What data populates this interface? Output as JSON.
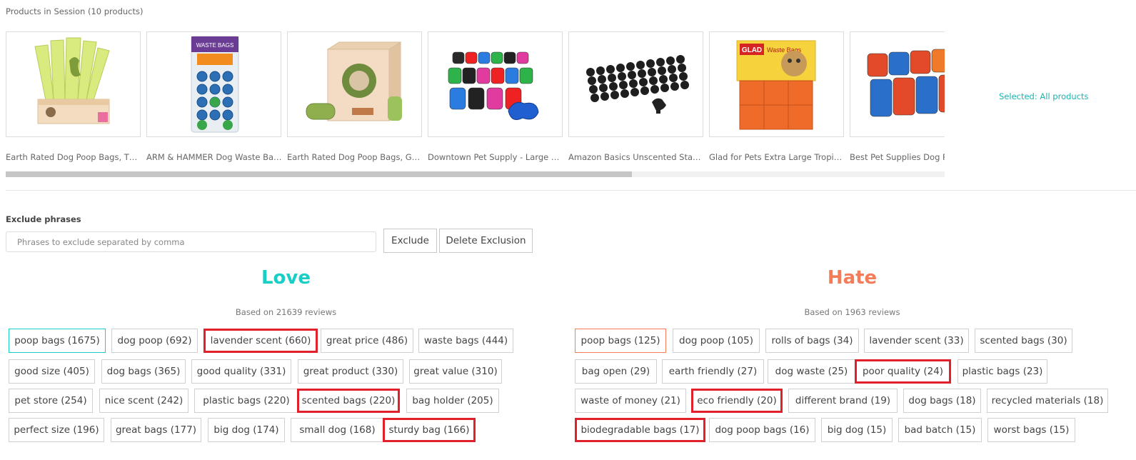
{
  "session": {
    "title": "Products in Session (10 products)",
    "selected_label": "Selected: All products"
  },
  "products": [
    {
      "title": "Earth Rated Dog Poop Bags, Thic..."
    },
    {
      "title": "ARM & HAMMER Dog Waste Bag..."
    },
    {
      "title": "Earth Rated Dog Poop Bags, Gua..."
    },
    {
      "title": "Downtown Pet Supply - Large D..."
    },
    {
      "title": "Amazon Basics Unscented Stand..."
    },
    {
      "title": "Glad for Pets Extra Large Tropic..."
    },
    {
      "title": "Best Pet Supplies Dog Poop Bags"
    }
  ],
  "exclude": {
    "label": "Exclude phrases",
    "placeholder": "Phrases to exclude separated by comma",
    "exclude_button": "Exclude",
    "delete_button": "Delete Exclusion"
  },
  "love": {
    "heading": "Love",
    "based_on": "Based on 21639 reviews",
    "accent": "#19cfc5",
    "tags": [
      "poop bags (1675)",
      "dog poop (692)",
      "lavender scent (660)",
      "great price (486)",
      "waste bags (444)",
      "good size (405)",
      "dog bags (365)",
      "good quality (331)",
      "great product (330)",
      "great value (310)",
      "pet store (254)",
      "nice scent (242)",
      "plastic bags (220)",
      "scented bags (220)",
      "bag holder (205)",
      "perfect size (196)",
      "great bags (177)",
      "big dog (174)",
      "small dog (168)",
      "sturdy bag (166)"
    ]
  },
  "hate": {
    "heading": "Hate",
    "based_on": "Based on 1963 reviews",
    "accent": "#f47c57",
    "tags": [
      "poop bags (125)",
      "dog poop (105)",
      "rolls of bags (34)",
      "lavender scent (33)",
      "scented bags (30)",
      "bag open (29)",
      "earth friendly (27)",
      "dog waste (25)",
      "poor quality (24)",
      "plastic bags (23)",
      "waste of money (21)",
      "eco friendly (20)",
      "different brand (19)",
      "dog bags (18)",
      "recycled materials (18)",
      "biodegradable bags (17)",
      "dog poop bags (16)",
      "big dog (15)",
      "bad batch (15)",
      "worst bags (15)"
    ]
  }
}
